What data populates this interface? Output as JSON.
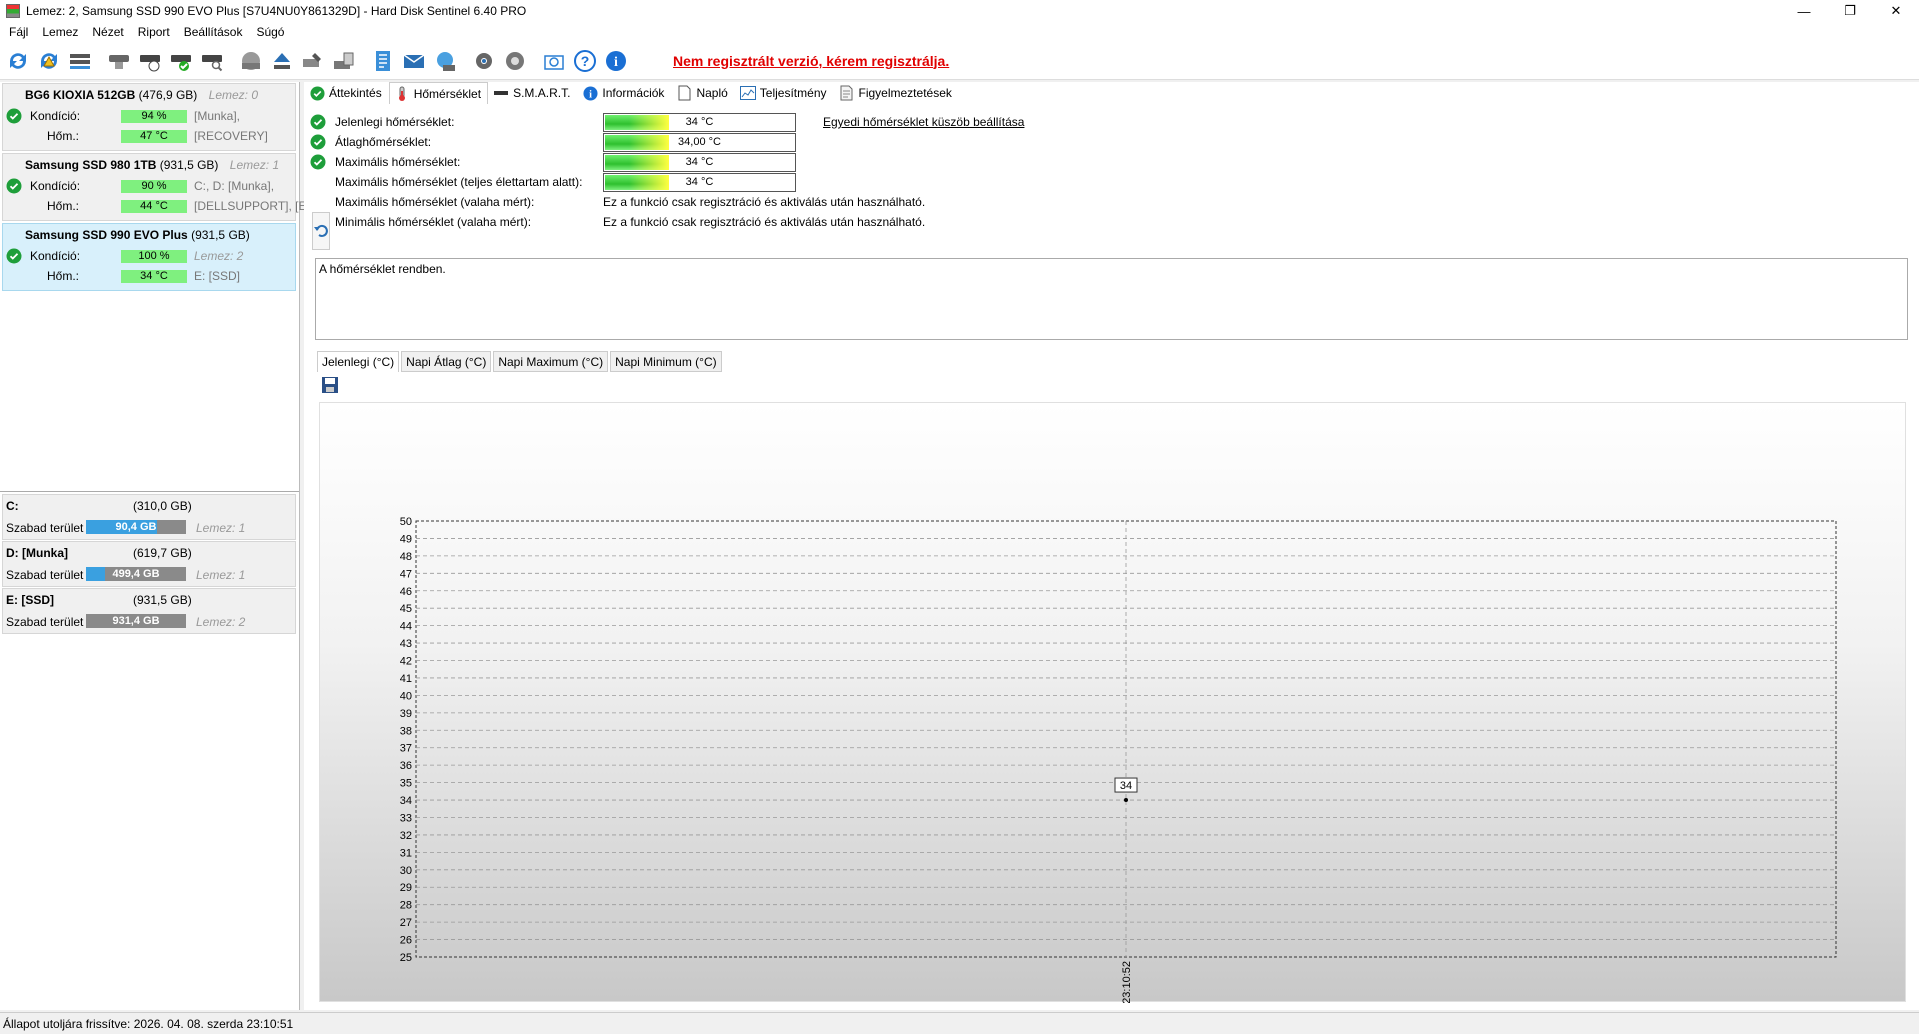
{
  "window": {
    "title": "Lemez: 2, Samsung SSD 990 EVO Plus [S7U4NU0Y861329D]  -  Hard Disk Sentinel 6.40 PRO",
    "minimize": "—",
    "maximize": "❐",
    "close": "✕"
  },
  "menu": [
    "Fájl",
    "Lemez",
    "Nézet",
    "Riport",
    "Beállítások",
    "Súgó"
  ],
  "toolbar": {
    "warning": "Nem regisztrált verzió, kérem regisztrálja."
  },
  "disks": [
    {
      "name": "BG6 KIOXIA 512GB",
      "capacity": "(476,9 GB)",
      "disk_no": "Lemez: 0",
      "health_label": "Kondíció:",
      "health": "94 %",
      "health_fill": 0.94,
      "health_aux": "[Munka],",
      "temp_label": "Hőm.:",
      "temp": "47 °C",
      "temp_aux": "[RECOVERY]"
    },
    {
      "name": "Samsung SSD 980 1TB",
      "capacity": "(931,5 GB)",
      "disk_no": "Lemez: 1",
      "health_label": "Kondíció:",
      "health": "90 %",
      "health_fill": 0.9,
      "health_aux": "C:, D: [Munka],",
      "temp_label": "Hőm.:",
      "temp": "44 °C",
      "temp_aux": "[DELLSUPPORT], [E"
    },
    {
      "name": "Samsung SSD 990 EVO Plus",
      "capacity": "(931,5 GB)",
      "disk_no": "",
      "health_label": "Kondíció:",
      "health": "100 %",
      "health_fill": 1.0,
      "health_aux": "Lemez: 2",
      "temp_label": "Hőm.:",
      "temp": "34 °C",
      "temp_aux": "E: [SSD]"
    }
  ],
  "volumes": [
    {
      "name": "C:",
      "capacity": "(310,0 GB)",
      "free_label": "Szabad terület",
      "free": "90,4 GB",
      "used_fraction": 0.71,
      "disk": "Lemez: 1"
    },
    {
      "name": "D: [Munka]",
      "capacity": "(619,7 GB)",
      "free_label": "Szabad terület",
      "free": "499,4 GB",
      "used_fraction": 0.19,
      "disk": "Lemez: 1"
    },
    {
      "name": "E: [SSD]",
      "capacity": "(931,5 GB)",
      "free_label": "Szabad terület",
      "free": "931,4 GB",
      "used_fraction": 0.0,
      "disk": "Lemez: 2"
    }
  ],
  "tabs": [
    "Áttekintés",
    "Hőmérséklet",
    "S.M.A.R.T.",
    "Információk",
    "Napló",
    "Teljesítmény",
    "Figyelmeztetések"
  ],
  "temperature": {
    "current_label": "Jelenlegi hőmérséklet:",
    "current": "34 °C",
    "avg_label": "Átlaghőmérséklet:",
    "avg": "34,00 °C",
    "max_label": "Maximális hőmérséklet:",
    "max": "34 °C",
    "lifetime_max_label": "Maximális hőmérséklet (teljes élettartam alatt):",
    "lifetime_max": "34 °C",
    "ever_max_label": "Maximális hőmérséklet (valaha mért):",
    "ever_min_label": "Minimális hőmérséklet (valaha mért):",
    "unavailable": "Ez a funkció csak regisztráció és aktiválás után használható.",
    "threshold_link": "Egyedi hőmérséklet küszöb beállítása",
    "status": "A hőmérséklet rendben.",
    "bar_fill": 0.34
  },
  "chart_tabs": [
    "Jelenlegi (°C)",
    "Napi Átlag (°C)",
    "Napi Maximum (°C)",
    "Napi Minimum (°C)"
  ],
  "chart_data": {
    "type": "line",
    "x": [
      "23:10:52"
    ],
    "series": [
      {
        "values": [
          34
        ]
      }
    ],
    "ylim": [
      25,
      50
    ],
    "yticks": [
      25,
      26,
      27,
      28,
      29,
      30,
      31,
      32,
      33,
      34,
      35,
      36,
      37,
      38,
      39,
      40,
      41,
      42,
      43,
      44,
      45,
      46,
      47,
      48,
      49,
      50
    ],
    "data_labels": [
      "34"
    ],
    "grid": true
  },
  "status_bar": "Állapot utoljára frissítve: 2026. 04. 08. szerda 23:10:51"
}
